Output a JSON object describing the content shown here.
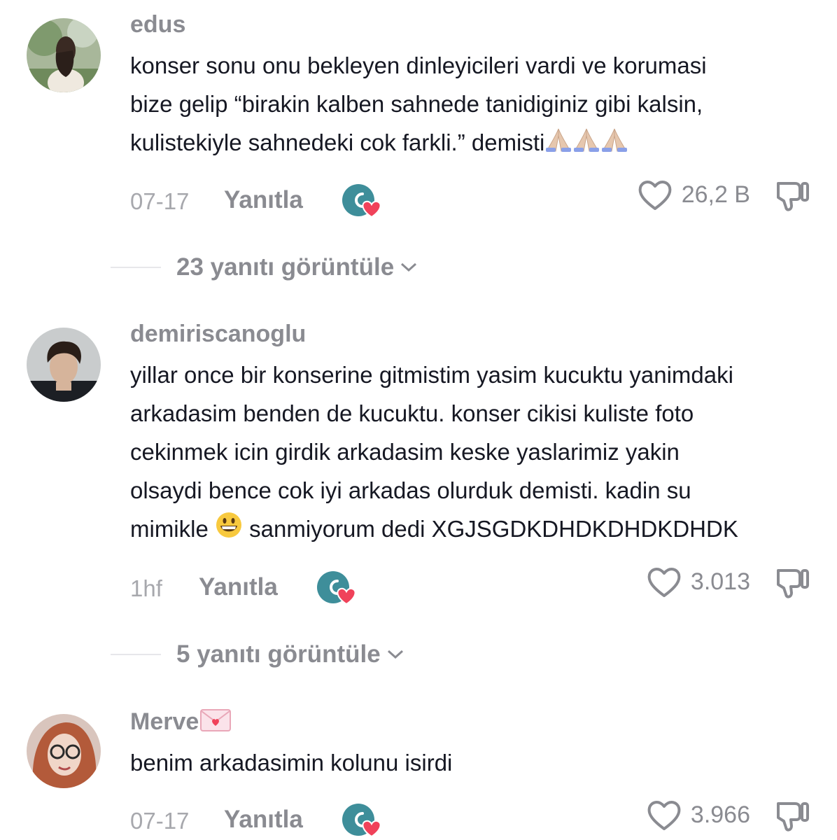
{
  "comments": [
    {
      "username": "edus",
      "lines": [
        "konser sonu onu bekleyen dinleyicileri vardi ve korumasi",
        "bize gelip “birakin kalben sahnede tanidiginiz gibi kalsin,",
        "kulistekiyle sahnedeki cok farkli.” demisti"
      ],
      "date": "07-17",
      "reply_label": "Yanıtla",
      "likes": "26,2 B",
      "view_replies": "23 yanıtı görüntüle"
    },
    {
      "username": "demiriscanoglu",
      "lines": [
        "yillar once bir konserine gitmistim yasim kucuktu yanimdaki",
        "arkadasim benden de kucuktu. konser cikisi kuliste foto",
        "cekinmek icin girdik arkadasim keske yaslarimiz yakin",
        "olsaydi bence cok iyi arkadas olurduk demisti. kadin su"
      ],
      "line5_pre": "mimikle",
      "line5_post": "sanmiyorum dedi XGJSGDKDHDKDHDKDHDK",
      "date": "1hf",
      "reply_label": "Yanıtla",
      "likes": "3.013",
      "view_replies": "5 yanıtı görüntüle"
    },
    {
      "username": "Merve",
      "lines": [
        "benim arkadasimin kolunu isirdi"
      ],
      "date": "07-17",
      "reply_label": "Yanıtla",
      "likes": "3.966"
    }
  ],
  "icons": {
    "react": "creator-heart-icon",
    "like": "heart-outline-icon",
    "dislike": "thumbs-down-icon",
    "expand": "chevron-down-icon",
    "prayer": "folded-hands-emoji",
    "grin": "grinning-face-emoji",
    "mail": "love-letter-emoji"
  },
  "colors": {
    "react_teal": "#3e8e9a",
    "heart_red": "#f0425a",
    "muted": "#8a8b91"
  }
}
